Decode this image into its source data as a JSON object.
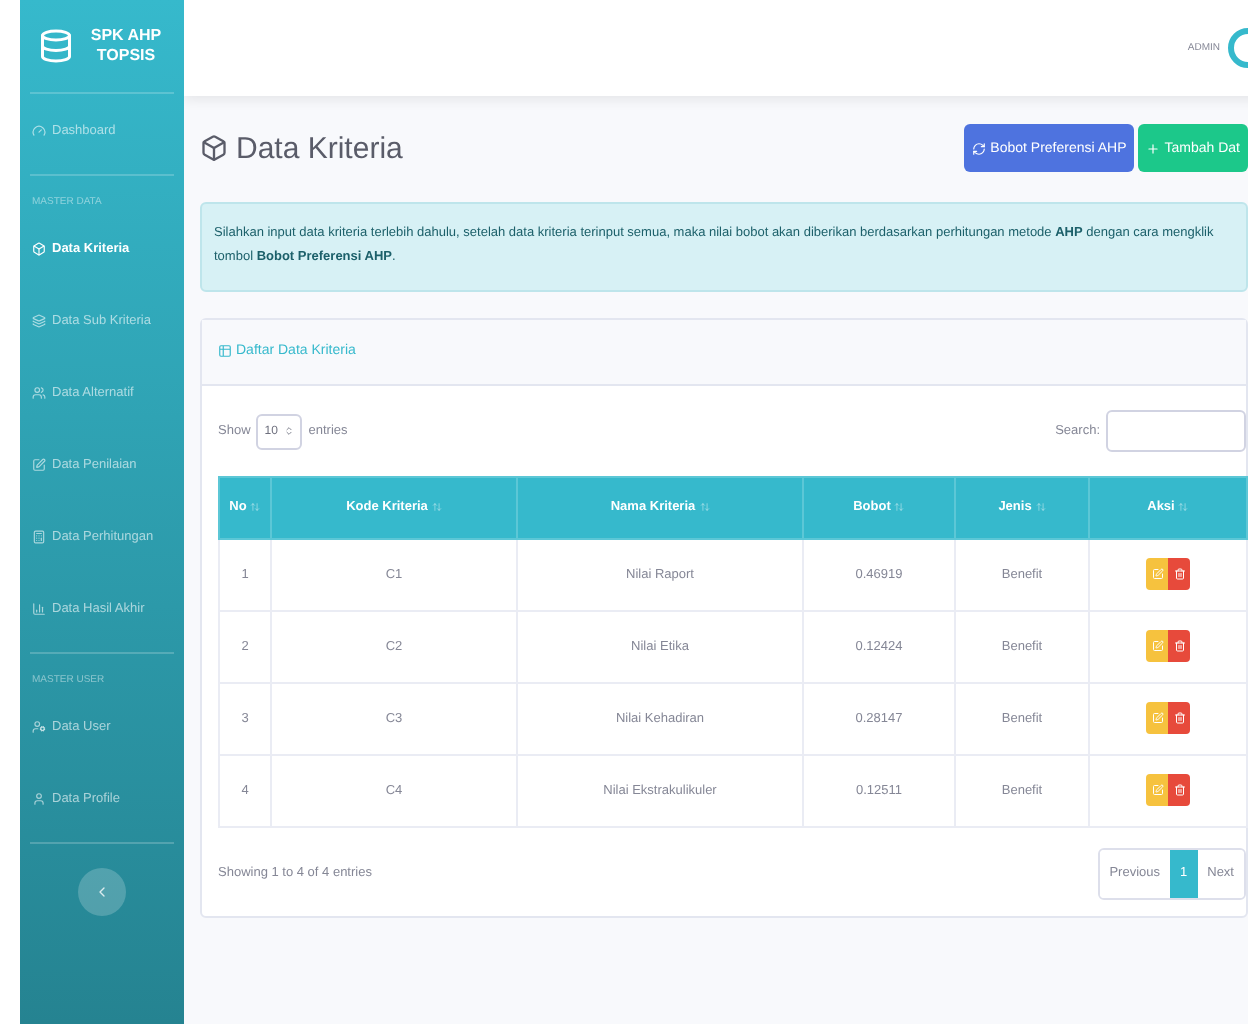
{
  "sidebar": {
    "brand": "SPK AHP TOPSIS",
    "groups": [
      {
        "items": [
          {
            "label": "Dashboard",
            "selected": false
          }
        ]
      },
      {
        "heading": "MASTER DATA",
        "items": [
          {
            "label": "Data Kriteria",
            "selected": true
          },
          {
            "label": "Data Sub Kriteria",
            "selected": false
          },
          {
            "label": "Data Alternatif",
            "selected": false
          },
          {
            "label": "Data Penilaian",
            "selected": false
          },
          {
            "label": "Data Perhitungan",
            "selected": false
          },
          {
            "label": "Data Hasil Akhir",
            "selected": false
          }
        ]
      },
      {
        "heading": "MASTER USER",
        "items": [
          {
            "label": "Data User",
            "selected": false
          },
          {
            "label": "Data Profile",
            "selected": false
          }
        ]
      }
    ]
  },
  "topbar": {
    "user": "ADMIN"
  },
  "page": {
    "title": "Data Kriteria",
    "buttons": [
      {
        "label": "Bobot Preferensi AHP",
        "kind": "primary"
      },
      {
        "label": "Tambah Dat",
        "kind": "success"
      }
    ],
    "alert": "Silahkan input data kriteria terlebih dahulu, setelah data kriteria terinput semua, maka nilai bobot akan diberikan berdasarkan perhitungan metode **AHP** dengan cara mengklik tombol **Bobot Preferensi AHP**."
  },
  "card": {
    "title": "Daftar Data Kriteria",
    "show_label": "Show",
    "page_size": "10",
    "entries_label": "entries",
    "search_label": "Search:",
    "table": {
      "columns": [
        "No",
        "Kode Kriteria",
        "Nama Kriteria",
        "Bobot",
        "Jenis",
        "Aksi"
      ],
      "rows": [
        [
          "1",
          "C1",
          "Nilai Raport",
          "0.46919",
          "Benefit"
        ],
        [
          "2",
          "C2",
          "Nilai Etika",
          "0.12424",
          "Benefit"
        ],
        [
          "3",
          "C3",
          "Nilai Kehadiran",
          "0.28147",
          "Benefit"
        ],
        [
          "4",
          "C4",
          "Nilai Ekstrakulikuler",
          "0.12511",
          "Benefit"
        ]
      ]
    },
    "info": "Showing 1 to 4 of 4 entries",
    "pagination": [
      {
        "label": "Previous",
        "selected": false
      },
      {
        "label": "1",
        "selected": true
      },
      {
        "label": "Next",
        "selected": false
      }
    ]
  }
}
